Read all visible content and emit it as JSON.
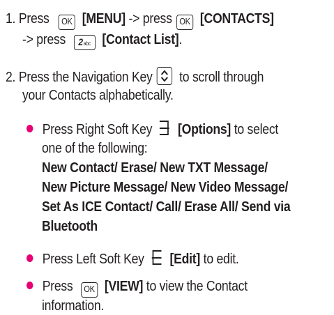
{
  "steps": {
    "s1": {
      "number": "1.",
      "press1": "Press",
      "menu": "[MENU]",
      "arrow1": "-> press",
      "contacts": "[CONTACTS]",
      "arrow2": "-> press",
      "contact_list": "[Contact List]",
      "end": "."
    },
    "s2": {
      "number": "2.",
      "text_a": "Press the Navigation Key",
      "text_b": "to scroll through",
      "text_c": "your Contacts alphabetically."
    }
  },
  "keys": {
    "ok": "OK",
    "two": "2",
    "two_sub": "abc"
  },
  "bullets": {
    "b1": {
      "text_a": "Press Right Soft Key",
      "options": "[Options]",
      "text_b": "to select",
      "text_c": "one of the following:",
      "list1": "New Contact/ Erase/ New TXT Message/",
      "list2": "New Picture Message/ New Video Message/",
      "list3": "Set As ICE Contact/ Call/ Erase All/ Send via",
      "list4": "Bluetooth"
    },
    "b2": {
      "text_a": "Press Left Soft Key",
      "edit": "[Edit]",
      "text_b": "to edit."
    },
    "b3": {
      "text_a": "Press",
      "view": "[VIEW]",
      "text_b": "to view the Contact",
      "text_c": "information."
    }
  },
  "colors": {
    "bullet": "#e60073",
    "text": "#231f20"
  }
}
